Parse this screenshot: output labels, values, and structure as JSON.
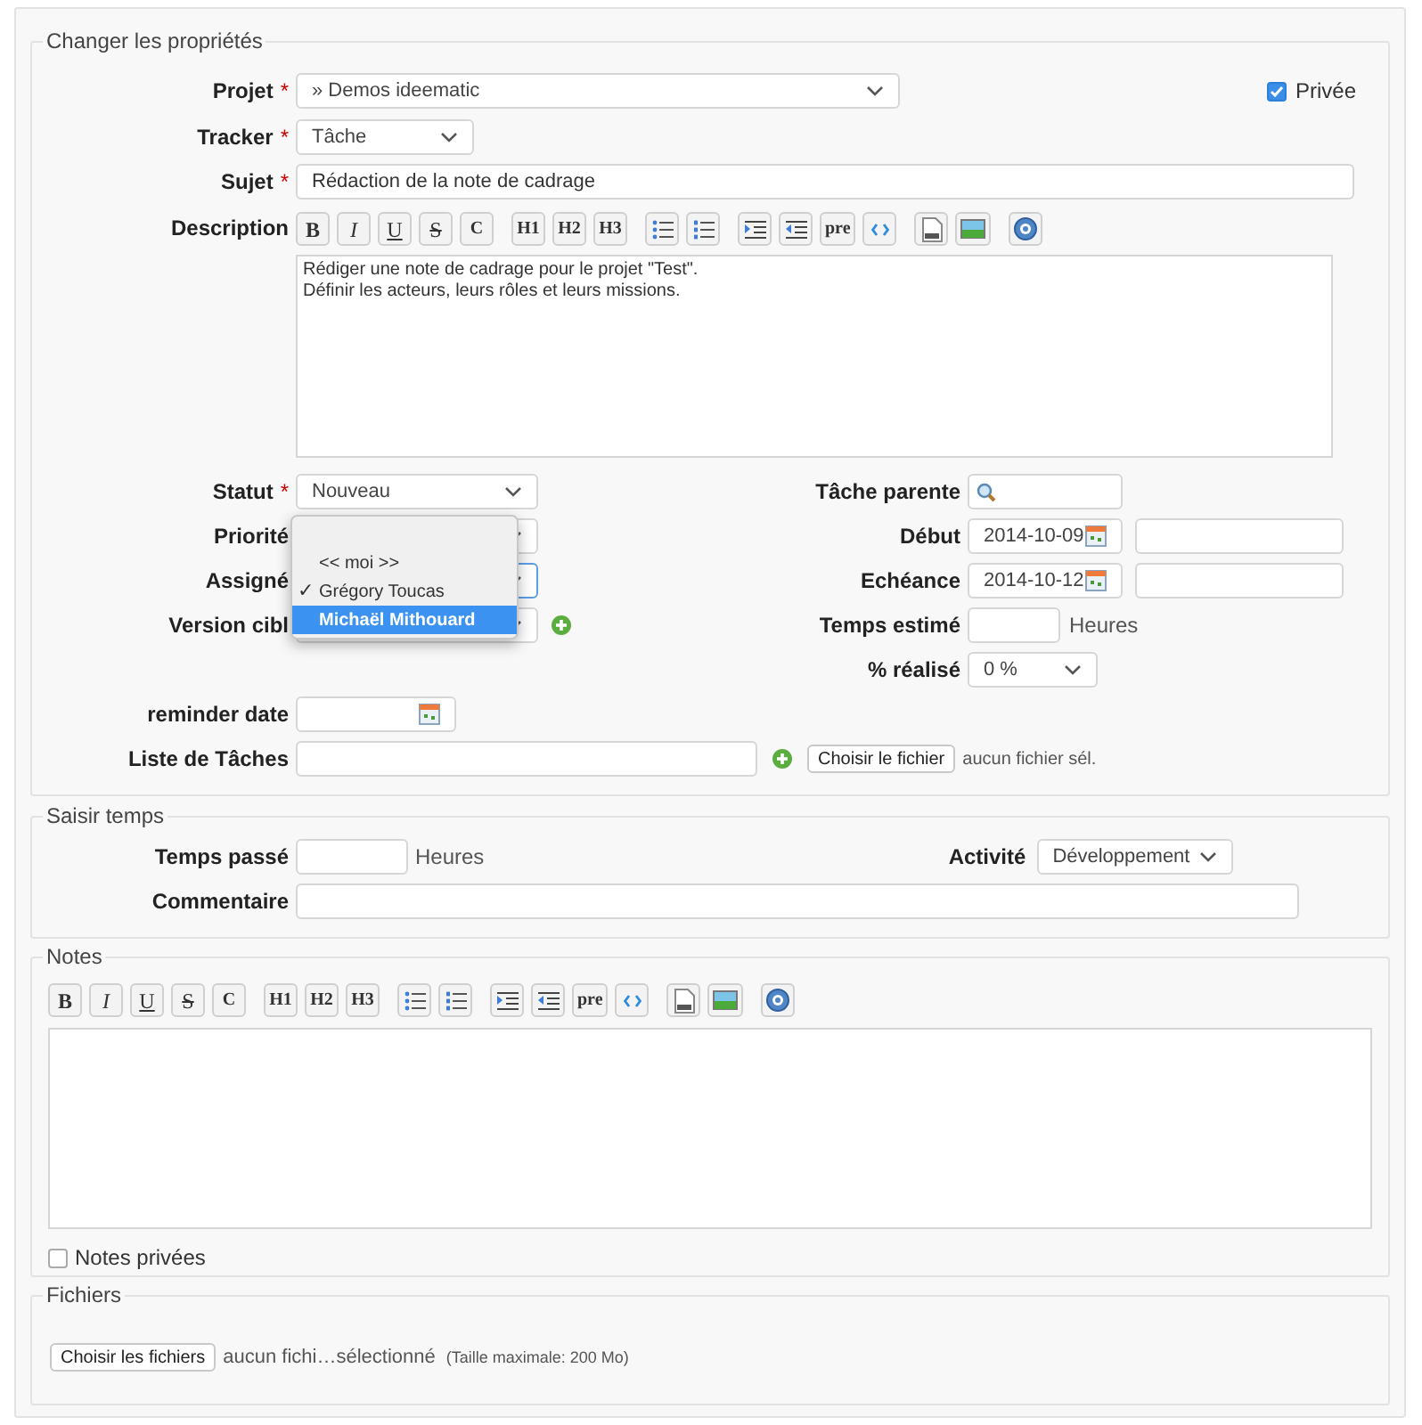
{
  "properties": {
    "legend": "Changer les propriétés",
    "project": {
      "label": "Projet",
      "required_mark": "*",
      "value": "» Demos ideematic"
    },
    "private": {
      "label": "Privée",
      "checked": true
    },
    "tracker": {
      "label": "Tracker",
      "required_mark": "*",
      "value": "Tâche"
    },
    "subject": {
      "label": "Sujet",
      "required_mark": "*",
      "value": "Rédaction de la note de cadrage"
    },
    "description": {
      "label": "Description",
      "toolbar": [
        [
          {
            "kind": "bold",
            "label": "B"
          },
          {
            "kind": "italic",
            "label": "I"
          },
          {
            "kind": "underline",
            "label": "U"
          },
          {
            "kind": "strike",
            "label": "S"
          },
          {
            "kind": "plain",
            "label": "C"
          }
        ],
        [
          {
            "kind": "plain",
            "label": "H1"
          },
          {
            "kind": "plain",
            "label": "H2"
          },
          {
            "kind": "plain",
            "label": "H3"
          }
        ],
        [
          {
            "kind": "bullets"
          },
          {
            "kind": "numbers"
          }
        ],
        [
          {
            "kind": "indent"
          },
          {
            "kind": "outdent"
          },
          {
            "kind": "plain",
            "label": "pre"
          },
          {
            "kind": "code"
          }
        ],
        [
          {
            "kind": "attachment"
          },
          {
            "kind": "image"
          }
        ],
        [
          {
            "kind": "help"
          }
        ]
      ],
      "lines": [
        "Rédiger une note de cadrage pour le projet \"Test\".",
        "Définir les acteurs, leurs rôles et leurs missions."
      ]
    },
    "left_fields": [
      {
        "label": "Statut",
        "required_mark": "*",
        "kind": "select",
        "value": "Nouveau",
        "focused": false,
        "add_button": false
      },
      {
        "label": "Priorité",
        "kind": "select",
        "focused": false,
        "add_button": false
      },
      {
        "label": "Assigné",
        "kind": "select",
        "focused": true,
        "add_button": false
      },
      {
        "label": "Version cibl",
        "kind": "select",
        "focused": false,
        "add_button": true
      }
    ],
    "right_fields": [
      {
        "label": "Tâche parente",
        "kind": "search"
      },
      {
        "label": "Début",
        "kind": "date",
        "value": "2014-10-09"
      },
      {
        "label": "Echéance",
        "kind": "date",
        "value": "2014-10-12"
      },
      {
        "label": "Temps estimé",
        "kind": "hours",
        "unit": "Heures"
      },
      {
        "label": "% réalisé",
        "kind": "select",
        "value": "0 %"
      }
    ],
    "reminder": {
      "label": "reminder date"
    },
    "task_list": {
      "label": "Liste de Tâches",
      "file_button": "Choisir le fichier",
      "file_status": "aucun fichier sél."
    },
    "dropdown": {
      "options": [
        {
          "label": "<< moi >>",
          "selected": false
        },
        {
          "check": "✓",
          "label": "Grégory Toucas",
          "selected": false
        },
        {
          "label": "Michaël Mithouard",
          "selected": true
        }
      ]
    }
  },
  "time": {
    "legend": "Saisir temps",
    "spent": {
      "label": "Temps passé",
      "unit": "Heures"
    },
    "activity": {
      "label": "Activité",
      "value": "Développement"
    },
    "comment": {
      "label": "Commentaire"
    }
  },
  "notes": {
    "legend": "Notes",
    "toolbar": [
      [
        {
          "kind": "bold",
          "label": "B"
        },
        {
          "kind": "italic",
          "label": "I"
        },
        {
          "kind": "underline",
          "label": "U"
        },
        {
          "kind": "strike",
          "label": "S"
        },
        {
          "kind": "plain",
          "label": "C"
        }
      ],
      [
        {
          "kind": "plain",
          "label": "H1"
        },
        {
          "kind": "plain",
          "label": "H2"
        },
        {
          "kind": "plain",
          "label": "H3"
        }
      ],
      [
        {
          "kind": "bullets"
        },
        {
          "kind": "numbers"
        }
      ],
      [
        {
          "kind": "indent"
        },
        {
          "kind": "outdent"
        },
        {
          "kind": "plain",
          "label": "pre"
        },
        {
          "kind": "code"
        }
      ],
      [
        {
          "kind": "attachment"
        },
        {
          "kind": "image"
        }
      ],
      [
        {
          "kind": "help"
        }
      ]
    ],
    "private": {
      "label": "Notes privées",
      "checked": false
    }
  },
  "files": {
    "legend": "Fichiers",
    "button": "Choisir les fichiers",
    "status": "aucun fichi…sélectionné",
    "max_size": "(Taille maximale: 200 Mo)"
  }
}
